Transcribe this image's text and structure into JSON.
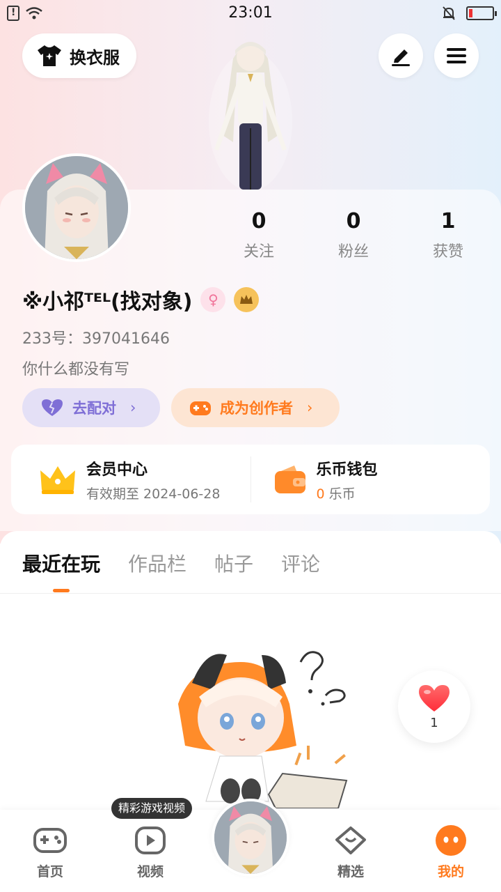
{
  "status_bar": {
    "time": "23:01"
  },
  "top": {
    "outfit_label": "换衣服"
  },
  "stats": [
    {
      "value": "0",
      "label": "关注"
    },
    {
      "value": "0",
      "label": "粉丝"
    },
    {
      "value": "1",
      "label": "获赞"
    }
  ],
  "profile": {
    "username": "※小祁ᵀᴱᴸ(找对象)",
    "id_text": "233号：397041646",
    "bio": "你什么都没有写"
  },
  "actions": {
    "match_label": "去配对",
    "creator_label": "成为创作者"
  },
  "vip": {
    "title": "会员中心",
    "subtitle": "有效期至 2024-06-28",
    "wallet_title": "乐币钱包",
    "wallet_value": "0",
    "wallet_unit": "乐币"
  },
  "tabs": [
    "最近在玩",
    "作品栏",
    "帖子",
    "评论"
  ],
  "like_count": "1",
  "tooltip": "精彩游戏视频",
  "nav": {
    "home": "首页",
    "video": "视频",
    "featured": "精选",
    "mine": "我的"
  },
  "colors": {
    "accent": "#ff7a1e",
    "match_purple": "#7f6fd6",
    "match_bg": "#e4e0f6",
    "creator_bg": "#fde5d3"
  }
}
